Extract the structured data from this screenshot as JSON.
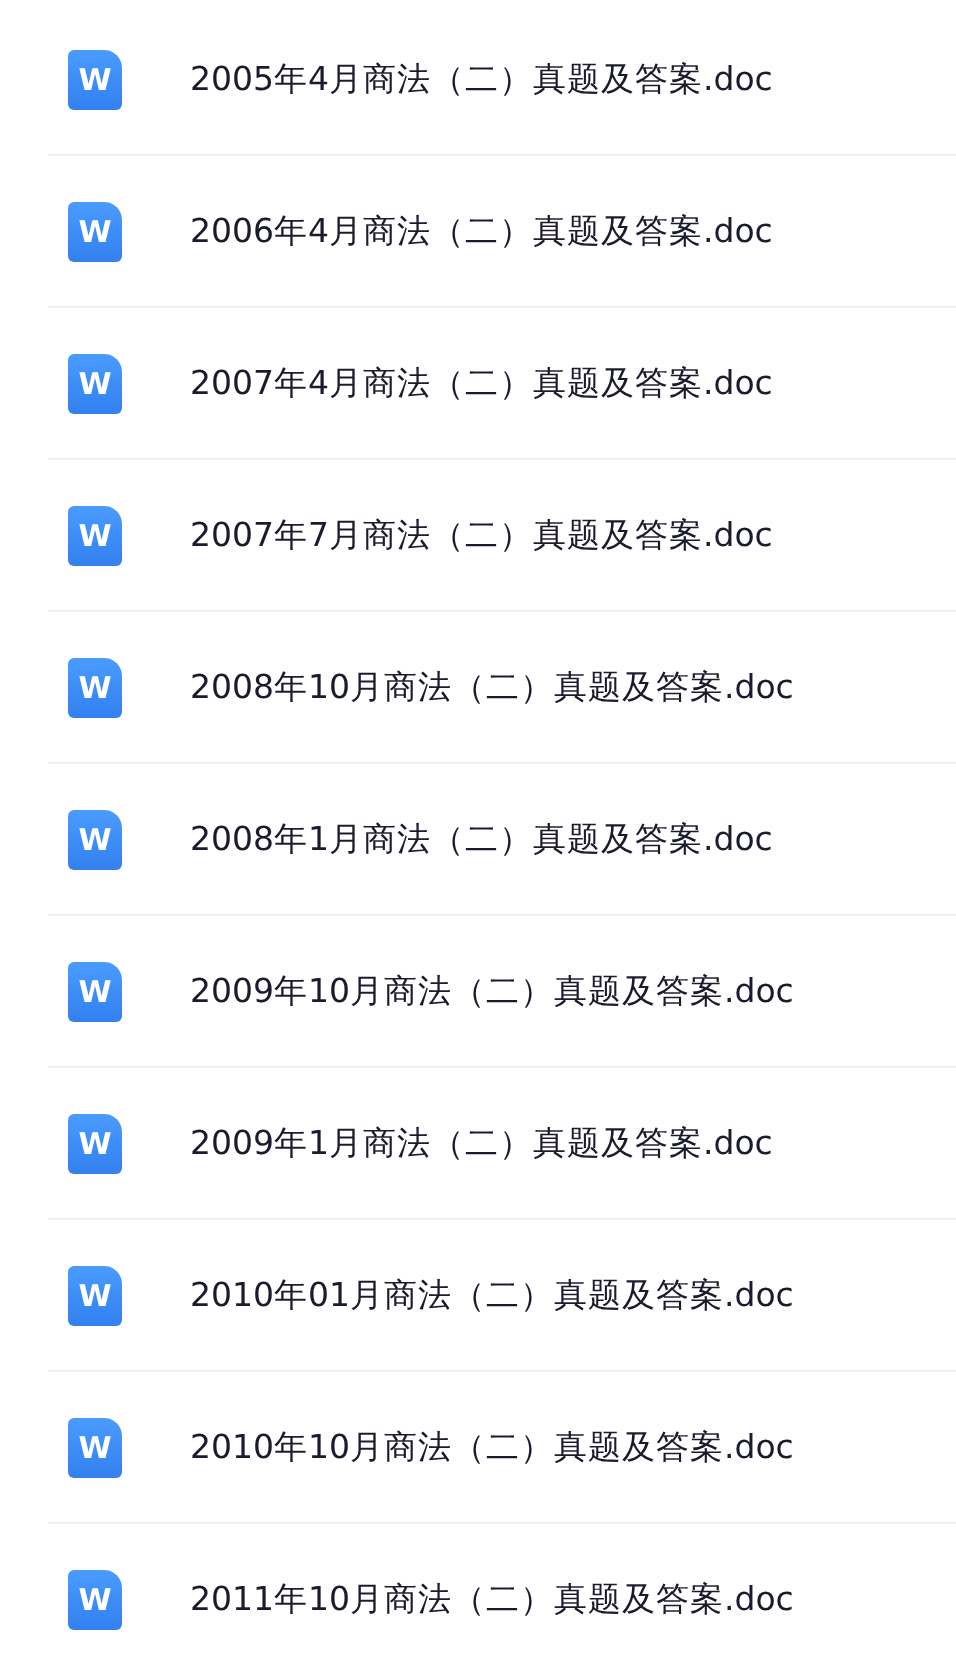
{
  "files": [
    {
      "icon": "W",
      "name": "2005年4月商法（二）真题及答案.doc"
    },
    {
      "icon": "W",
      "name": "2006年4月商法（二）真题及答案.doc"
    },
    {
      "icon": "W",
      "name": "2007年4月商法（二）真题及答案.doc"
    },
    {
      "icon": "W",
      "name": "2007年7月商法（二）真题及答案.doc"
    },
    {
      "icon": "W",
      "name": "2008年10月商法（二）真题及答案.doc"
    },
    {
      "icon": "W",
      "name": "2008年1月商法（二）真题及答案.doc"
    },
    {
      "icon": "W",
      "name": "2009年10月商法（二）真题及答案.doc"
    },
    {
      "icon": "W",
      "name": "2009年1月商法（二）真题及答案.doc"
    },
    {
      "icon": "W",
      "name": "2010年01月商法（二）真题及答案.doc"
    },
    {
      "icon": "W",
      "name": "2010年10月商法（二）真题及答案.doc"
    },
    {
      "icon": "W",
      "name": "2011年10月商法（二）真题及答案.doc"
    }
  ]
}
